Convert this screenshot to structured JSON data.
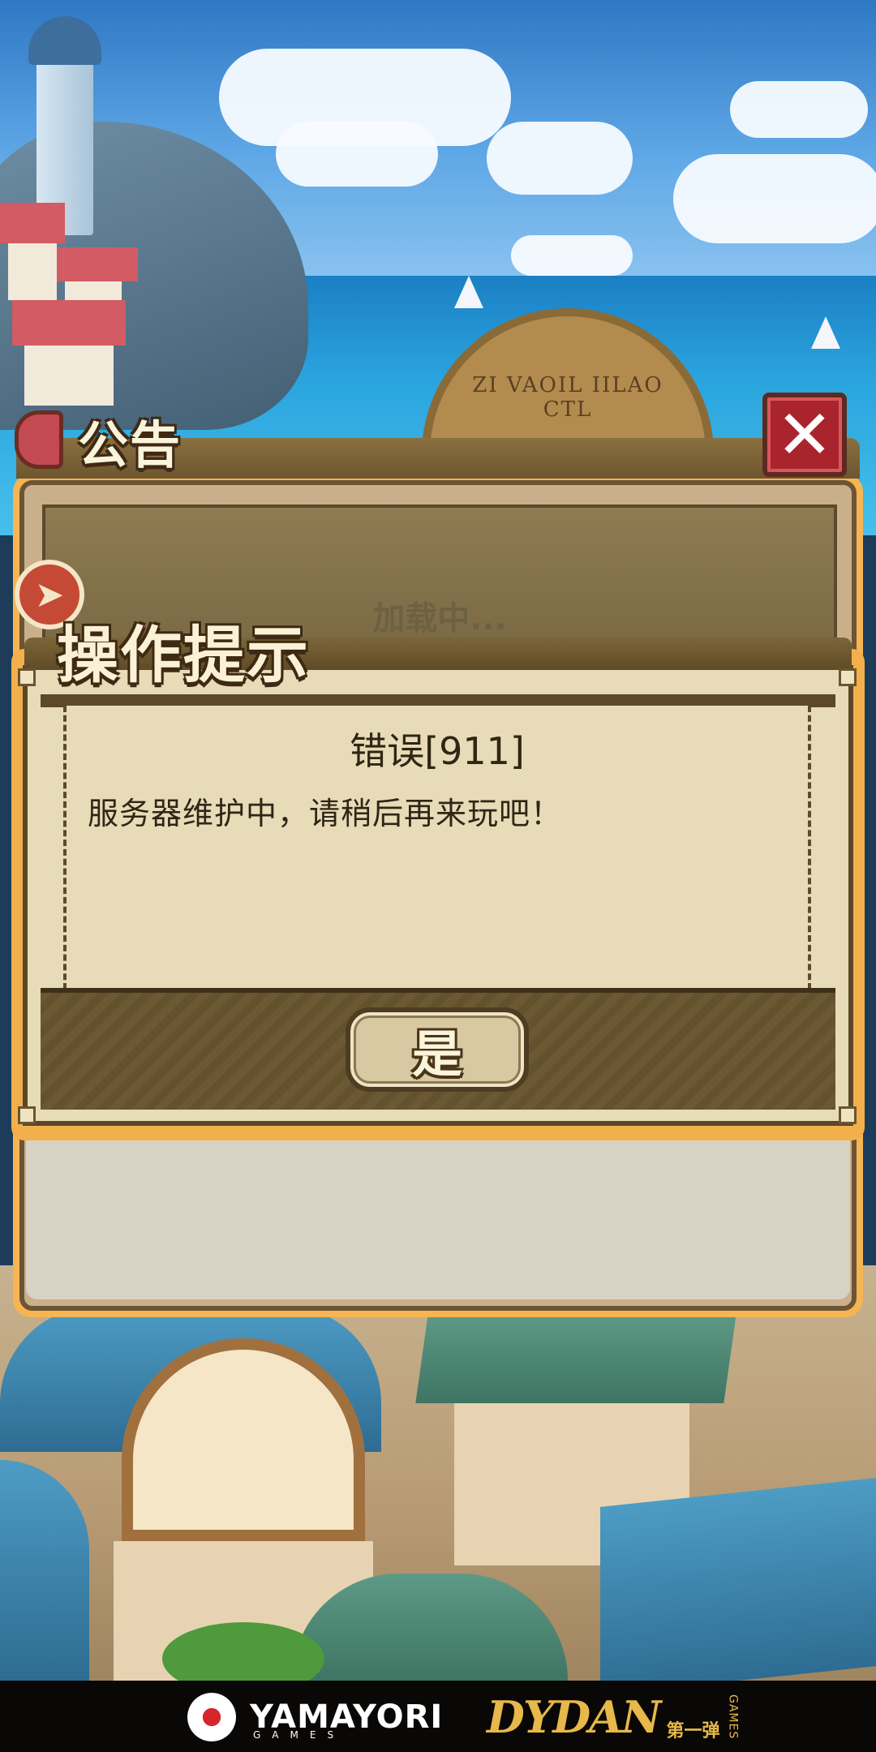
{
  "announcement": {
    "title": "公告",
    "loading_text": "加载中..."
  },
  "logo": {
    "gear_text": "ZI VAOIL IILAO CTL"
  },
  "dialog": {
    "title": "操作提示",
    "message_title": "错误[911]",
    "message_text": "服务器维护中，请稍后再来玩吧！",
    "confirm_label": "是"
  },
  "footer": {
    "brand_left": "YAMAYORI",
    "brand_left_sub": "GAMES",
    "brand_right": "DYDAN",
    "brand_right_cn": "第一弹",
    "brand_right_games": "GAMES"
  },
  "colors": {
    "close_button": "#a9242d",
    "dialog_frame": "#f2b04c",
    "dialog_body": "#e7dcb7",
    "title_text": "#fbf1d6"
  },
  "icons": {
    "close": "close-x-icon",
    "arrow": "arrow-badge-icon",
    "scroll": "scroll-icon",
    "flower": "flower-logo-icon"
  }
}
